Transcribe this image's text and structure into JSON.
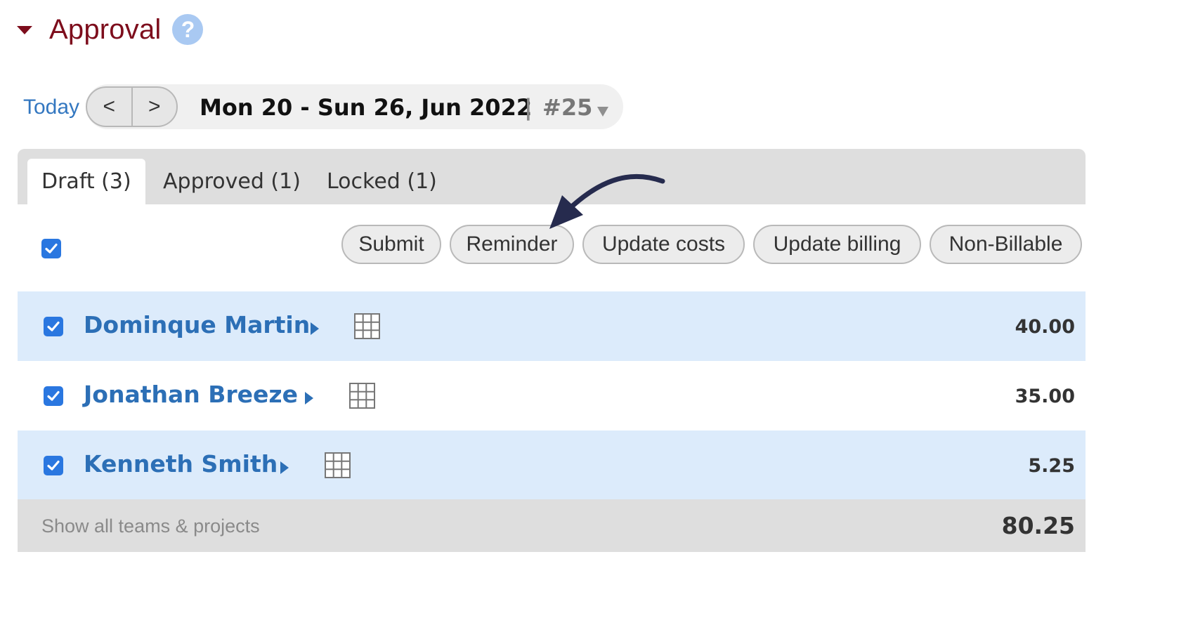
{
  "section": {
    "title": "Approval",
    "help_icon": "?"
  },
  "date_nav": {
    "today_label": "Today",
    "prev_label": "<",
    "next_label": ">",
    "range_label": "Mon 20 - Sun 26, Jun 2022",
    "separator": "|",
    "week_label": "#25"
  },
  "tabs": [
    {
      "label": "Draft (3)",
      "active": true
    },
    {
      "label": "Approved (1)",
      "active": false
    },
    {
      "label": "Locked (1)",
      "active": false
    }
  ],
  "actions": {
    "submit": "Submit",
    "reminder": "Reminder",
    "update_costs": "Update costs",
    "update_billing": "Update billing",
    "non_billable": "Non-Billable"
  },
  "rows": [
    {
      "name": "Dominque Martin",
      "hours": "40.00",
      "checked": true
    },
    {
      "name": "Jonathan Breeze",
      "hours": "35.00",
      "checked": true
    },
    {
      "name": "Kenneth Smith",
      "hours": "5.25",
      "checked": true
    }
  ],
  "footer": {
    "link": "Show all teams & projects",
    "total": "80.25"
  },
  "colors": {
    "title": "#7d0d1c",
    "link": "#2c6fb6",
    "checkbox": "#2a77e0",
    "row_highlight": "#dcebfb",
    "arrow": "#262b4e"
  }
}
